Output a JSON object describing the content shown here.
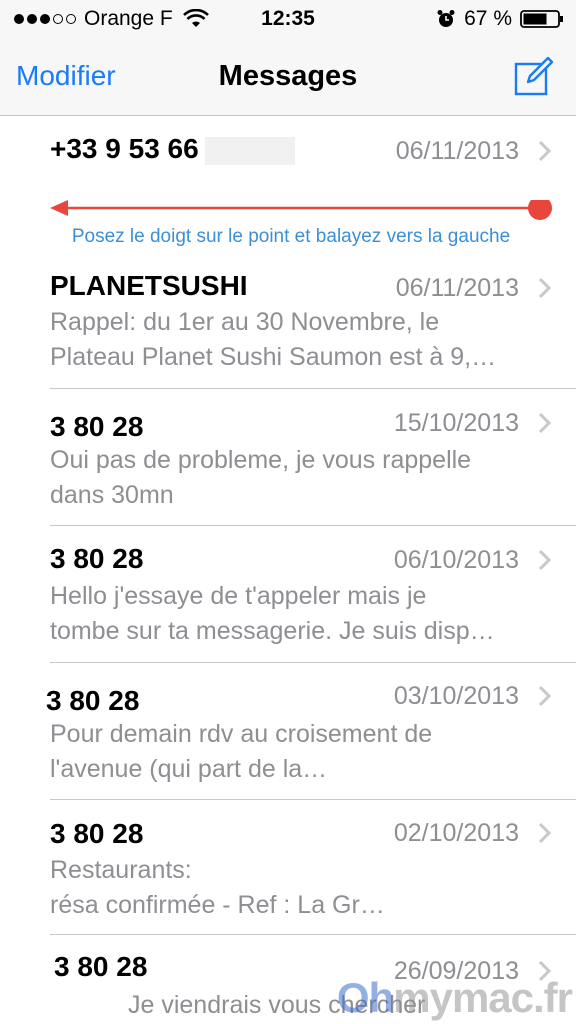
{
  "status_bar": {
    "carrier": "Orange F",
    "time": "12:35",
    "battery": "67 %"
  },
  "nav": {
    "left_button": "Modifier",
    "title": "Messages"
  },
  "annotation": {
    "hint": "Posez le doigt sur le point et balayez vers la gauche",
    "arrow_color": "#e8453c"
  },
  "messages": [
    {
      "name": "+33 9 53 66",
      "date": "06/11/2013",
      "lines": []
    },
    {
      "name": "PLANETSUSHI",
      "date": "06/11/2013",
      "lines": [
        "Rappel: du 1er au 30 Novembre, le",
        "Plateau Planet Sushi Saumon est à 9,…"
      ]
    },
    {
      "name": "3 80 28",
      "date": "15/10/2013",
      "lines": [
        "Oui pas de probleme, je vous rappelle",
        "dans 30mn"
      ]
    },
    {
      "name": "3 80 28",
      "date": "06/10/2013",
      "lines": [
        "Hello j'essaye de t'appeler mais je",
        "tombe sur ta messagerie. Je suis disp…"
      ]
    },
    {
      "name": "3 80 28",
      "date": "03/10/2013",
      "lines": [
        "Pour demain rdv au croisement de",
        "l'avenue                         (qui part de la…"
      ]
    },
    {
      "name": "3 80 28",
      "date": "02/10/2013",
      "lines": [
        "             Restaurants:",
        "résa confirmée - Ref                     : La Gr…"
      ]
    },
    {
      "name": "3 80 28",
      "date": "26/09/2013",
      "lines": [
        "Je viendrais vous chercher"
      ]
    }
  ],
  "watermark": {
    "prefix": "Oh",
    "rest": "mymac.fr"
  },
  "colors": {
    "accent": "#1a7cf5",
    "secondary_text": "#8e8e93",
    "separator": "#c8c7cc"
  },
  "icons": [
    "wifi-icon",
    "alarm-icon",
    "battery-icon",
    "compose-icon",
    "chevron-right-icon"
  ]
}
